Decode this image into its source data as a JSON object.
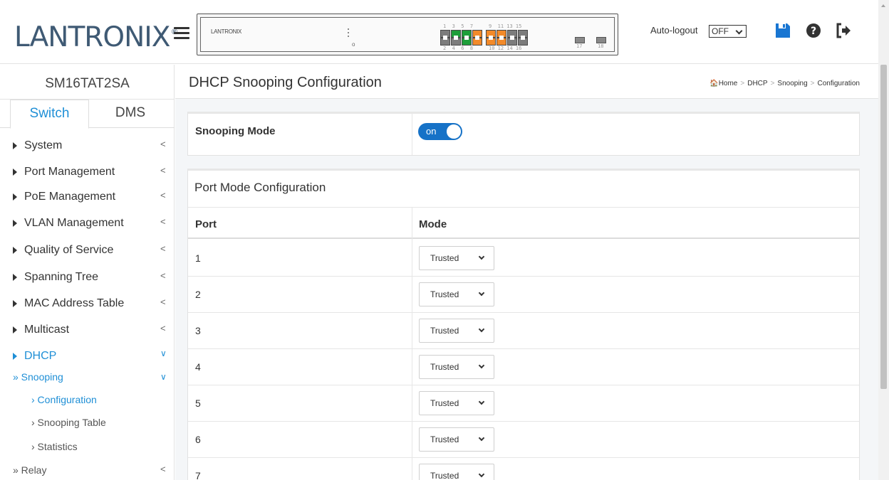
{
  "header": {
    "logo_text": "LANTRONIX",
    "logo_reg": "®",
    "panel_brand": "LANTRONIX",
    "ports_top_numbers_a": "1  3  5  7",
    "ports_bottom_numbers_a": "2  4  6  8",
    "ports_top_numbers_b": "9  11 13 15",
    "ports_bottom_numbers_b": "10 12 14 16",
    "sfp_labels": [
      "17",
      "18"
    ],
    "auto_logout_label": "Auto-logout",
    "auto_logout_value": "OFF",
    "colors": {
      "port_green": "#1e9e3a",
      "port_orange": "#f28a2a",
      "port_gray": "#7c7c7c",
      "icon_blue": "#1976d2"
    },
    "icons": [
      "menu-icon",
      "save-icon",
      "help-icon",
      "logout-icon"
    ]
  },
  "sidebar": {
    "device_name": "SM16TAT2SA",
    "tabs": [
      {
        "label": "Switch"
      },
      {
        "label": "DMS"
      }
    ],
    "items": [
      {
        "label": "System"
      },
      {
        "label": "Port Management"
      },
      {
        "label": "PoE Management"
      },
      {
        "label": "VLAN Management"
      },
      {
        "label": "Quality of Service"
      },
      {
        "label": "Spanning Tree"
      },
      {
        "label": "MAC Address Table"
      },
      {
        "label": "Multicast"
      },
      {
        "label": "DHCP"
      }
    ],
    "dhcp_sub": {
      "snooping": "» Snooping",
      "configuration": "› Configuration",
      "snooping_table": "› Snooping Table",
      "statistics": "› Statistics",
      "relay": "» Relay"
    },
    "accent": "#1f8fd6"
  },
  "main": {
    "page_title": "DHCP Snooping Configuration",
    "breadcrumb": [
      "Home",
      "DHCP",
      "Snooping",
      "Configuration"
    ],
    "snooping_mode_label": "Snooping Mode",
    "snooping_mode_value": "on",
    "port_mode_title": "Port Mode Configuration",
    "columns": {
      "port": "Port",
      "mode": "Mode"
    },
    "rows": [
      {
        "port": "1",
        "mode": "Trusted"
      },
      {
        "port": "2",
        "mode": "Trusted"
      },
      {
        "port": "3",
        "mode": "Trusted"
      },
      {
        "port": "4",
        "mode": "Trusted"
      },
      {
        "port": "5",
        "mode": "Trusted"
      },
      {
        "port": "6",
        "mode": "Trusted"
      },
      {
        "port": "7",
        "mode": "Trusted"
      }
    ],
    "toggle_color": "#1672c7"
  }
}
